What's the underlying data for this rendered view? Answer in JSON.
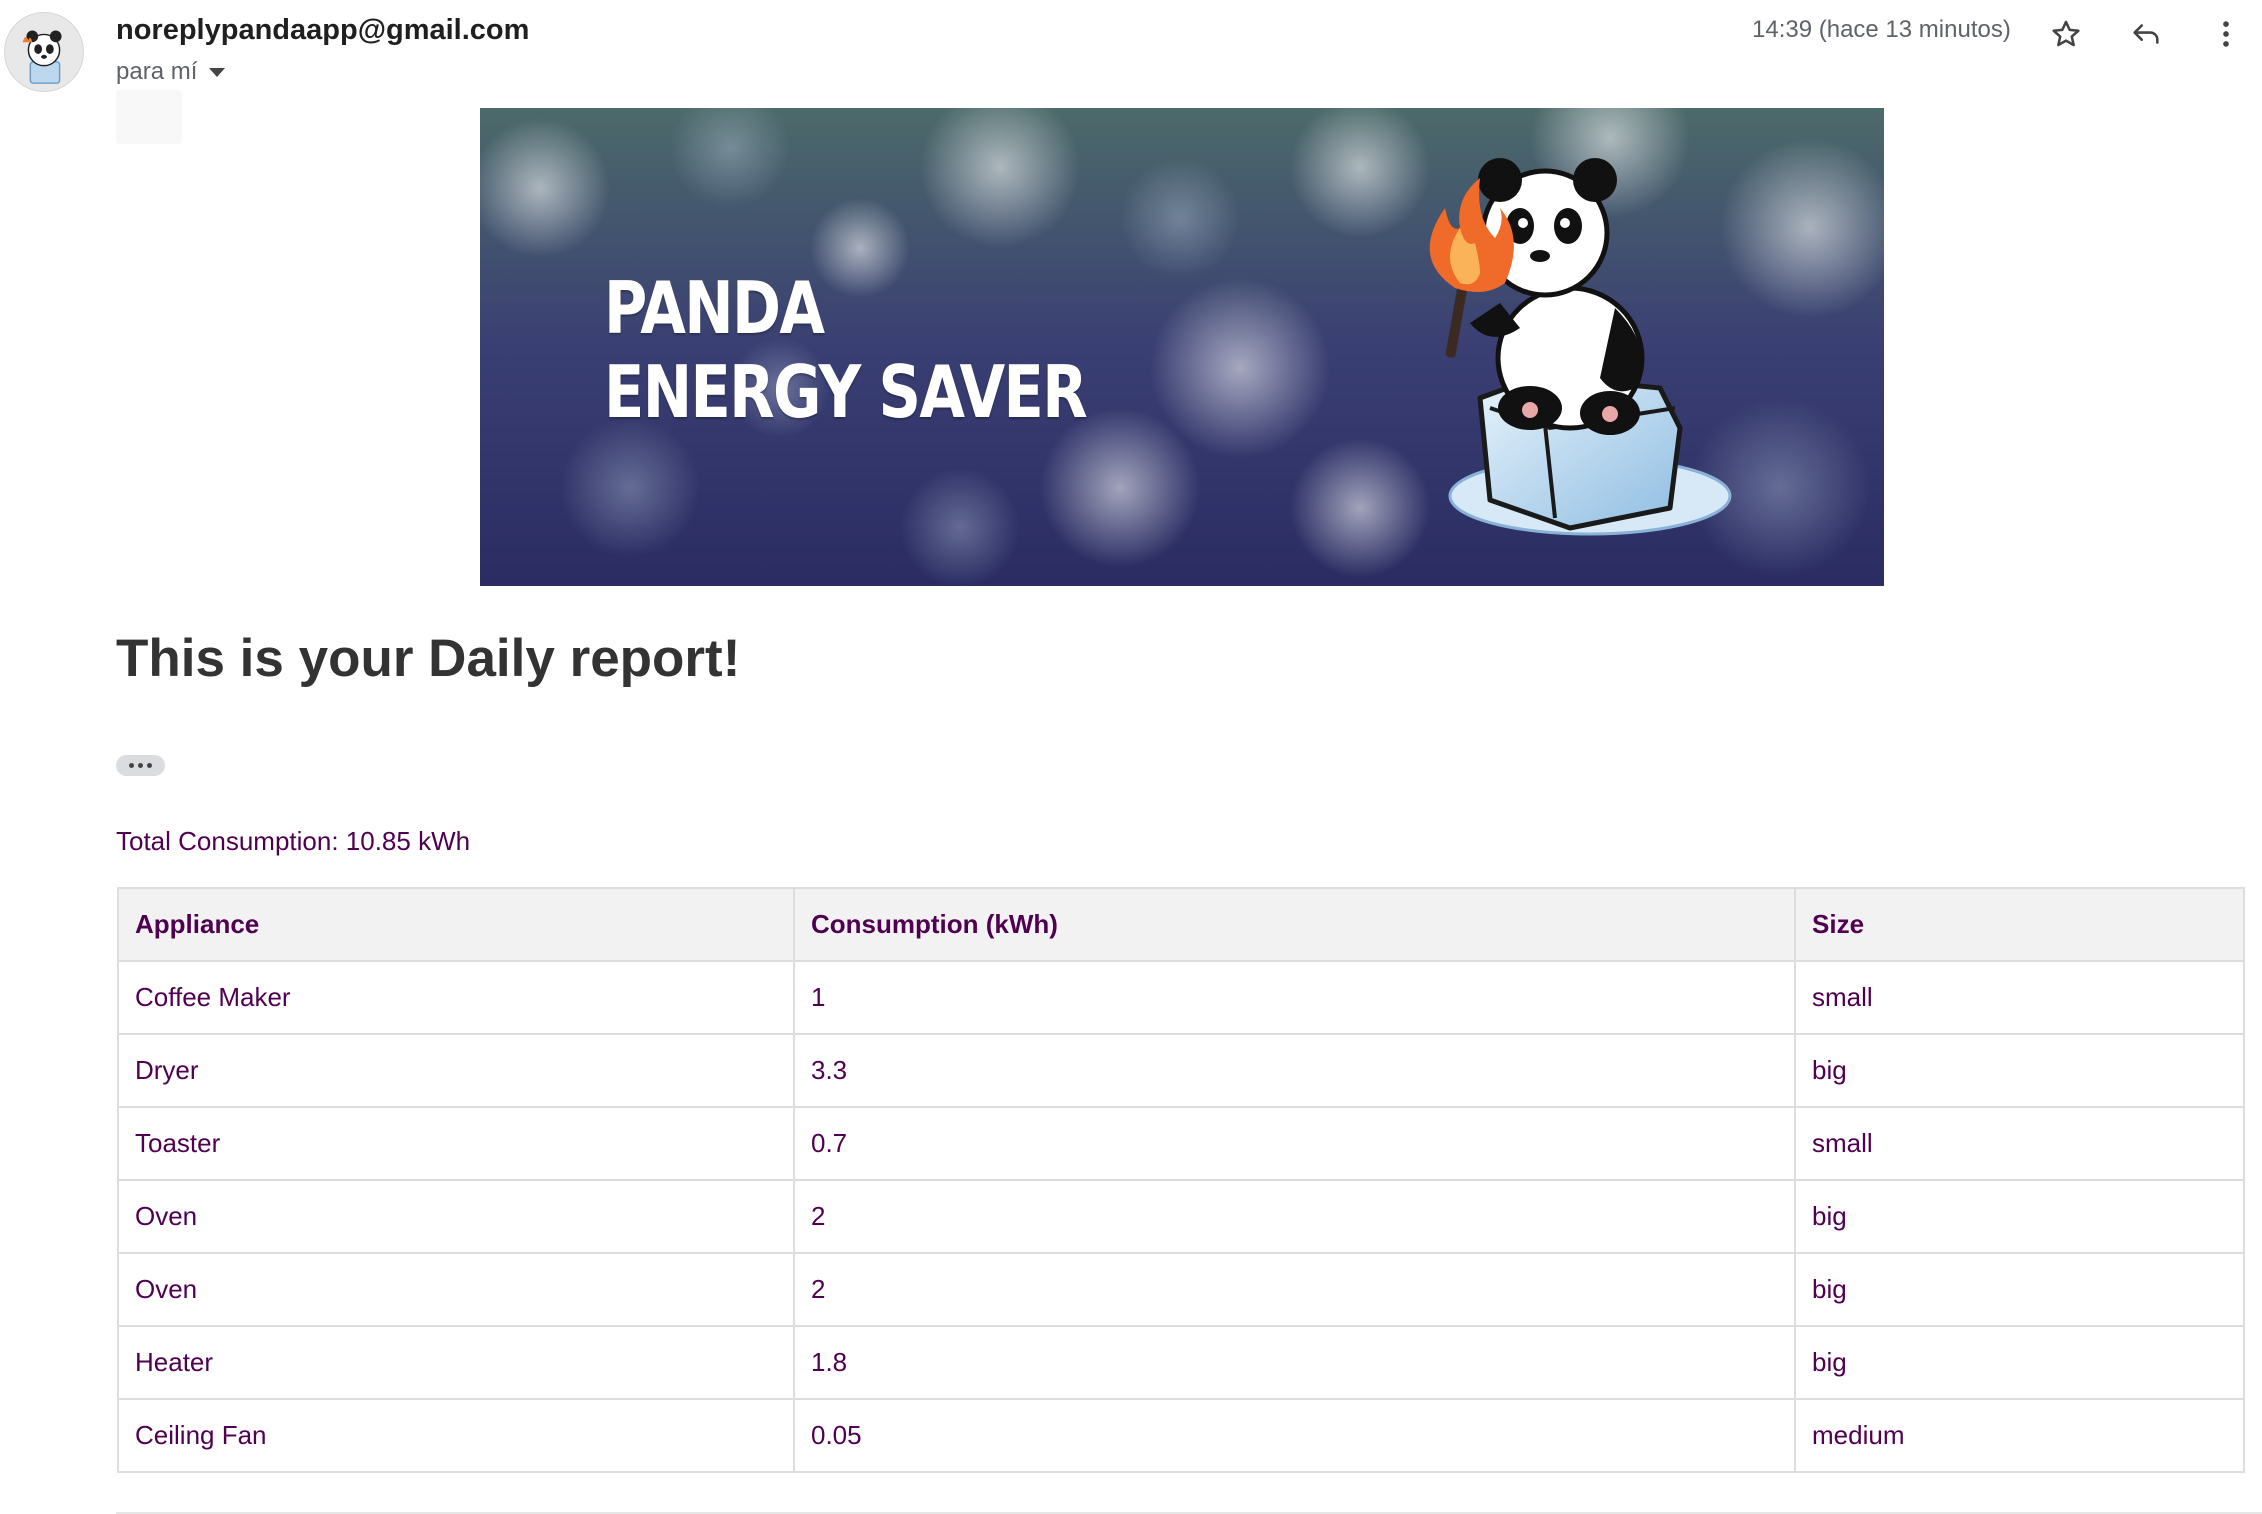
{
  "email": {
    "sender": "noreplypandaapp@gmail.com",
    "recipient": "para mí",
    "timestamp": "14:39 (hace 13 minutos)"
  },
  "icons": {
    "avatar": "panda-avatar-icon",
    "recipient_caret": "caret-down-icon",
    "star": "star-icon",
    "reply": "reply-icon",
    "more": "more-vert-icon"
  },
  "banner": {
    "title_line1": "PANDA",
    "title_line2": "ENERGY SAVER"
  },
  "report": {
    "title": "This is your Daily report!",
    "total_label": "Total Consumption: 10.85 kWh",
    "table": {
      "headers": [
        "Appliance",
        "Consumption (kWh)",
        "Size"
      ],
      "rows": [
        [
          "Coffee Maker",
          "1",
          "small"
        ],
        [
          "Dryer",
          "3.3",
          "big"
        ],
        [
          "Toaster",
          "0.7",
          "small"
        ],
        [
          "Oven",
          "2",
          "big"
        ],
        [
          "Oven",
          "2",
          "big"
        ],
        [
          "Heater",
          "1.8",
          "big"
        ],
        [
          "Ceiling Fan",
          "0.05",
          "medium"
        ]
      ]
    }
  },
  "colors": {
    "table_text": "#500050",
    "table_border": "#dddddd",
    "header_bg": "#f2f2f2",
    "title_text": "#333333"
  }
}
